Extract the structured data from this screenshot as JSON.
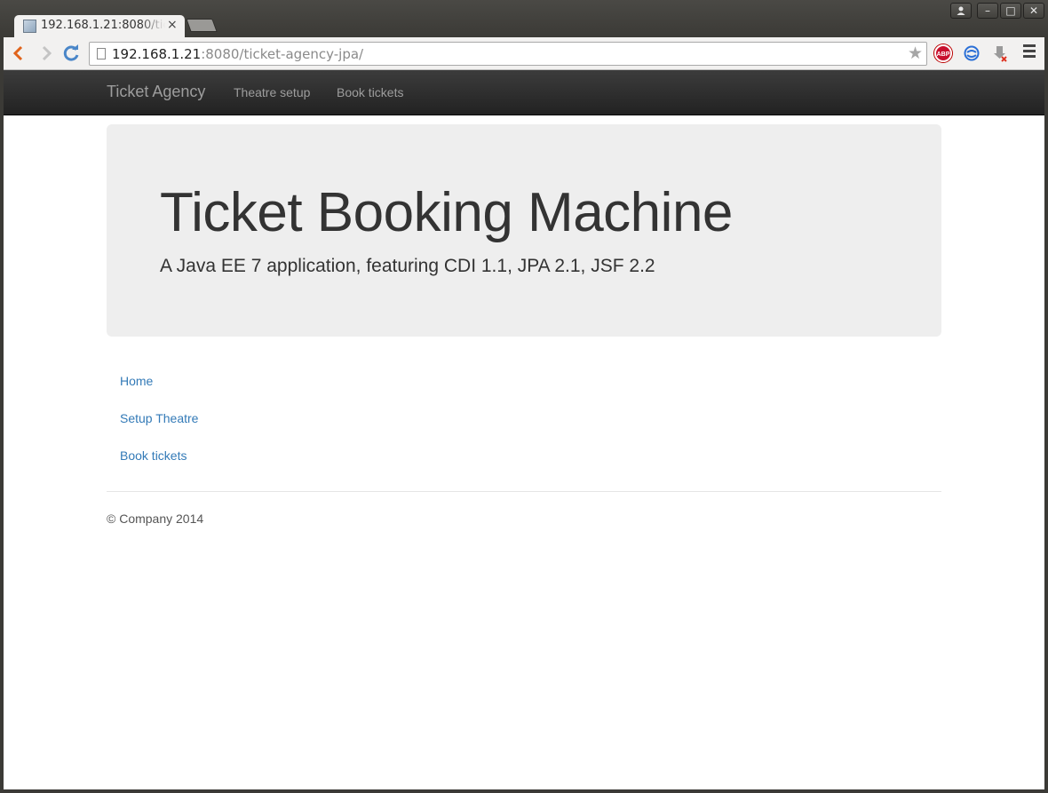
{
  "browser": {
    "tab_title": "192.168.1.21:8080/ticket-agency-jpa/",
    "tab_close": "×",
    "url_host": "192.168.1.21",
    "url_path": ":8080/ticket-agency-jpa/",
    "extensions": {
      "adblock_label": "ABP"
    },
    "window_buttons": {
      "user": "⛹",
      "minimize": "–",
      "maximize": "□",
      "close": "✕"
    }
  },
  "navbar": {
    "brand": "Ticket Agency",
    "links": [
      "Theatre setup",
      "Book tickets"
    ]
  },
  "jumbotron": {
    "title": "Ticket Booking Machine",
    "subtitle": "A Java EE 7 application, featuring CDI 1.1, JPA 2.1, JSF 2.2"
  },
  "sidebar": {
    "links": [
      "Home",
      "Setup Theatre",
      "Book tickets"
    ]
  },
  "footer": {
    "text": "© Company 2014"
  },
  "colors": {
    "navbar_bg": "#222222",
    "link": "#337ab7",
    "jumbotron_bg": "#eeeeee"
  }
}
